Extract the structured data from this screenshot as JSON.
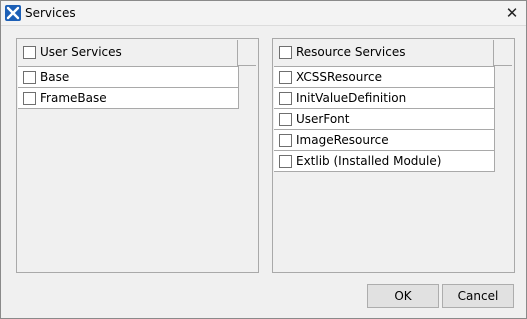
{
  "window": {
    "title": "Services",
    "close_glyph": "✕"
  },
  "user_services": {
    "header": "User Services",
    "items": [
      {
        "label": "Base",
        "checked": false
      },
      {
        "label": "FrameBase",
        "checked": false
      }
    ]
  },
  "resource_services": {
    "header": "Resource Services",
    "items": [
      {
        "label": "XCSSResource",
        "checked": false
      },
      {
        "label": "InitValueDefinition",
        "checked": false
      },
      {
        "label": "UserFont",
        "checked": false
      },
      {
        "label": "ImageResource",
        "checked": false
      },
      {
        "label": "Extlib (Installed Module)",
        "checked": false
      }
    ]
  },
  "buttons": {
    "ok": "OK",
    "cancel": "Cancel"
  },
  "colors": {
    "app_icon": "#1c5fb6",
    "grid_line": "#a9a9a9",
    "background": "#f0f0f0"
  }
}
